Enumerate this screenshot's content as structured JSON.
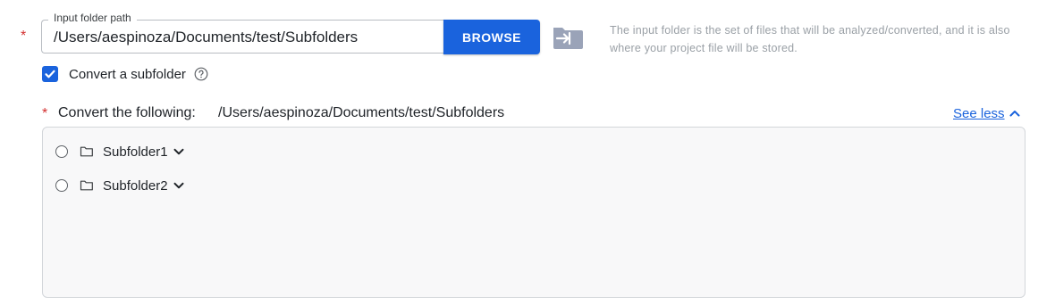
{
  "input_folder": {
    "required_marker": "*",
    "legend": "Input folder path",
    "value": "/Users/aespinoza/Documents/test/Subfolders",
    "browse_label": "BROWSE",
    "browse_icon": "folder-arrow-icon",
    "helper_text": "The input folder is the set of files that will be analyzed/converted, and it is also where your project file will be stored."
  },
  "subfolder_option": {
    "checked": true,
    "label": "Convert a subfolder",
    "help_icon": "question-circle-icon"
  },
  "convert_section": {
    "required_marker": "*",
    "title": "Convert the following:",
    "path": "/Users/aespinoza/Documents/test/Subfolders",
    "toggle_label": "See less",
    "toggle_icon": "chevron-up-icon",
    "items": [
      {
        "label": "Subfolder1",
        "selected": false
      },
      {
        "label": "Subfolder2",
        "selected": false
      }
    ]
  },
  "colors": {
    "accent": "#1a63dd",
    "required": "#d32f2f",
    "helper_text": "#9aa0a6",
    "box_background": "#f8f8f9"
  }
}
